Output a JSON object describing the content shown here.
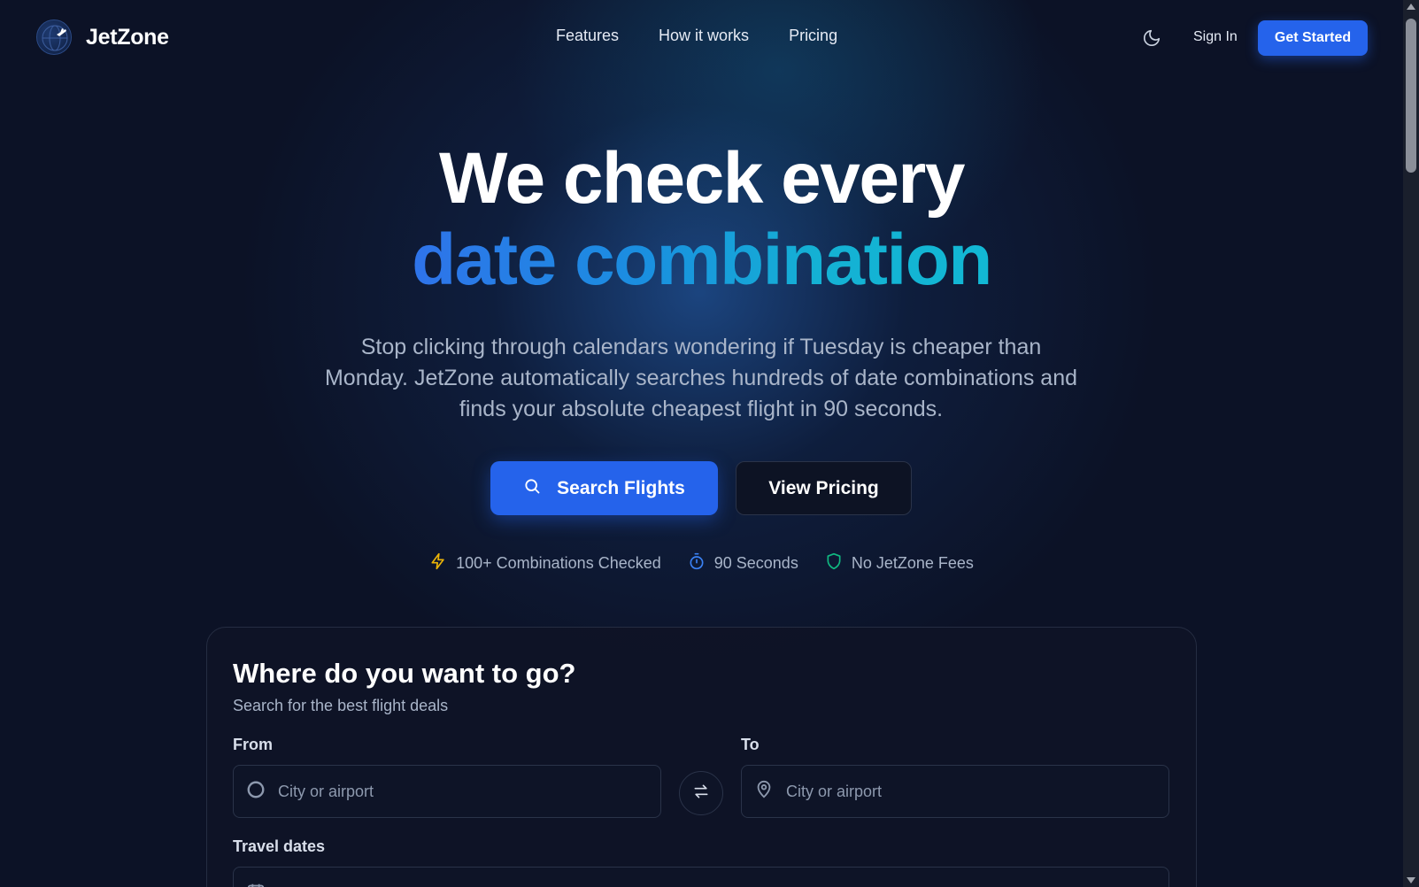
{
  "brand": {
    "name": "JetZone"
  },
  "nav": {
    "items": [
      {
        "label": "Features"
      },
      {
        "label": "How it works"
      },
      {
        "label": "Pricing"
      }
    ]
  },
  "header": {
    "signin_label": "Sign In",
    "cta_label": "Get Started"
  },
  "hero": {
    "title_line1": "We check every",
    "title_line2": "date combination",
    "subtitle": "Stop clicking through calendars wondering if Tuesday is cheaper than Monday. JetZone automatically searches hundreds of date combinations and finds your absolute cheapest flight in 90 seconds.",
    "primary_button": "Search Flights",
    "secondary_button": "View Pricing"
  },
  "stats": [
    {
      "icon": "lightning-icon",
      "label": "100+ Combinations Checked",
      "color": "#eab308"
    },
    {
      "icon": "timer-icon",
      "label": "90 Seconds",
      "color": "#3b82f6"
    },
    {
      "icon": "shield-icon",
      "label": "No JetZone Fees",
      "color": "#10b981"
    }
  ],
  "search_card": {
    "title": "Where do you want to go?",
    "subtitle": "Search for the best flight deals",
    "from_label": "From",
    "from_placeholder": "City or airport",
    "to_label": "To",
    "to_placeholder": "City or airport",
    "dates_label": "Travel dates"
  },
  "colors": {
    "accent": "#2563eb",
    "background": "#0c1226"
  }
}
